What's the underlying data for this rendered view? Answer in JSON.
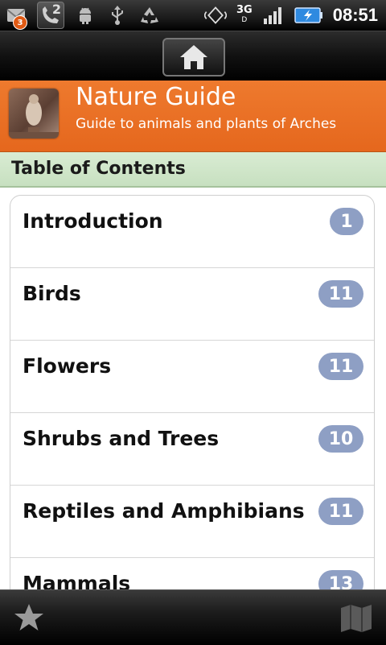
{
  "status_bar": {
    "notification_count": "3",
    "call_count": "2",
    "network_type": "3G",
    "network_sub": "D",
    "time": "08:51",
    "icons": [
      "gmail-notification-icon",
      "missed-call-icon",
      "android-debug-icon",
      "usb-icon",
      "recycle-icon",
      "gps-icon",
      "signal-icon",
      "battery-charging-icon"
    ]
  },
  "home_button": {
    "icon": "home-icon"
  },
  "header": {
    "title": "Nature Guide",
    "subtitle": "Guide to animals and plants of Arches",
    "background_color": "#e96f23"
  },
  "toc": {
    "heading": "Table of Contents",
    "items": [
      {
        "label": "Introduction",
        "count": "1"
      },
      {
        "label": "Birds",
        "count": "11"
      },
      {
        "label": "Flowers",
        "count": "11"
      },
      {
        "label": "Shrubs and Trees",
        "count": "10"
      },
      {
        "label": "Reptiles and Amphibians",
        "count": "11"
      },
      {
        "label": "Mammals",
        "count": "13"
      }
    ],
    "badge_color": "#8e9fc4"
  },
  "bottom_bar": {
    "left_icon": "star-icon",
    "right_icon": "map-icon"
  }
}
